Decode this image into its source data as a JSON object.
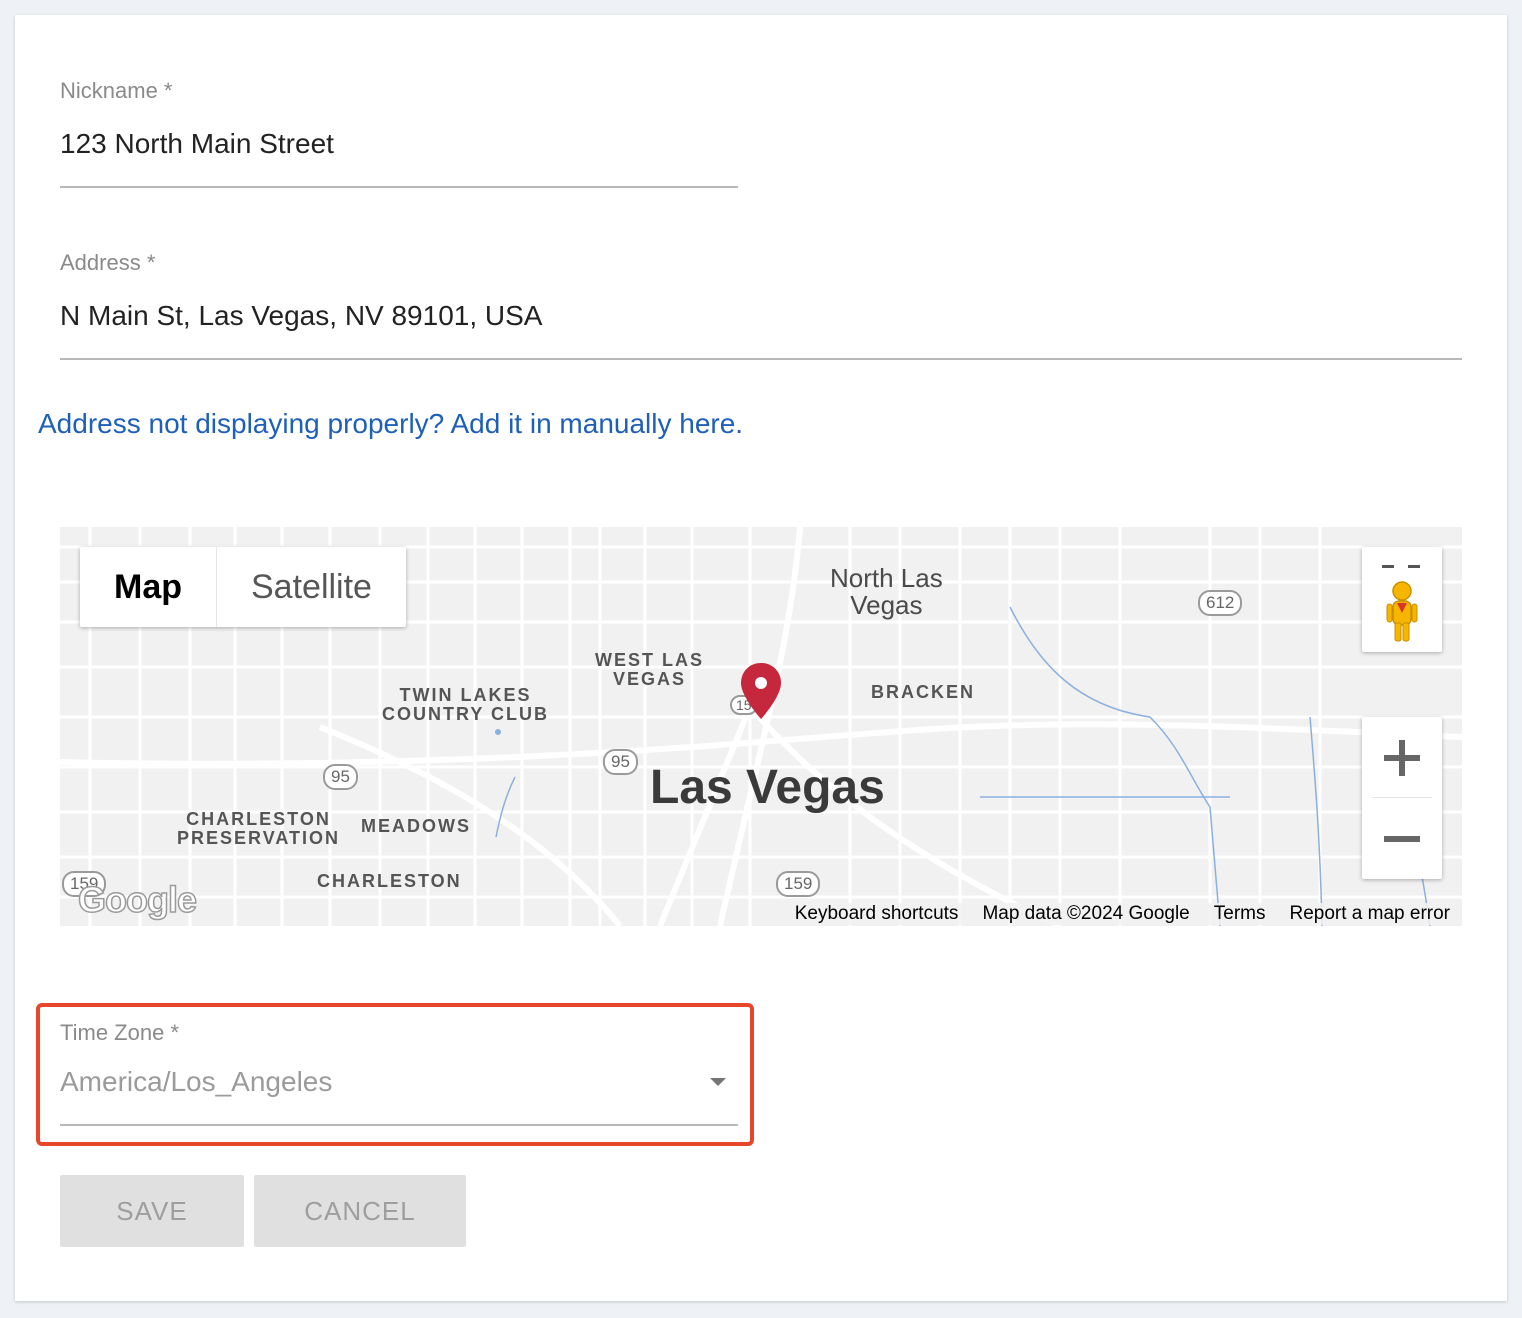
{
  "form": {
    "nickname": {
      "label": "Nickname *",
      "value": "123 North Main Street"
    },
    "address": {
      "label": "Address *",
      "value": "N Main St, Las Vegas, NV 89101, USA"
    },
    "manual_link": "Address not displaying properly? Add it in manually here.",
    "timezone": {
      "label": "Time Zone *",
      "value": "America/Los_Angeles"
    },
    "buttons": {
      "save": "SAVE",
      "cancel": "CANCEL"
    },
    "highlight_color": "#e8462a",
    "link_color": "#1e5fb8"
  },
  "map": {
    "type_tabs": [
      "Map",
      "Satellite"
    ],
    "selected_tab": "Map",
    "zoom_in": "+",
    "zoom_out": "−",
    "logo": "Google",
    "attribution": [
      "Keyboard shortcuts",
      "Map data ©2024 Google",
      "Terms",
      "Report a map error"
    ],
    "places": {
      "north_las_vegas": "North Las\nVegas",
      "west_las_vegas": "WEST LAS\nVEGAS",
      "twin_lakes": "TWIN LAKES\nCOUNTRY CLUB",
      "bracken": "BRACKEN",
      "las_vegas": "Las Vegas",
      "charleston_preservation": "CHARLESTON\nPRESERVATION",
      "meadows": "MEADOWS",
      "charleston": "CHARLESTON"
    },
    "route_shields": {
      "r612": "612",
      "r95a": "95",
      "r95b": "95",
      "r159a": "159",
      "r159b": "159",
      "i15": "15"
    },
    "pin_color": "#c5283d"
  }
}
